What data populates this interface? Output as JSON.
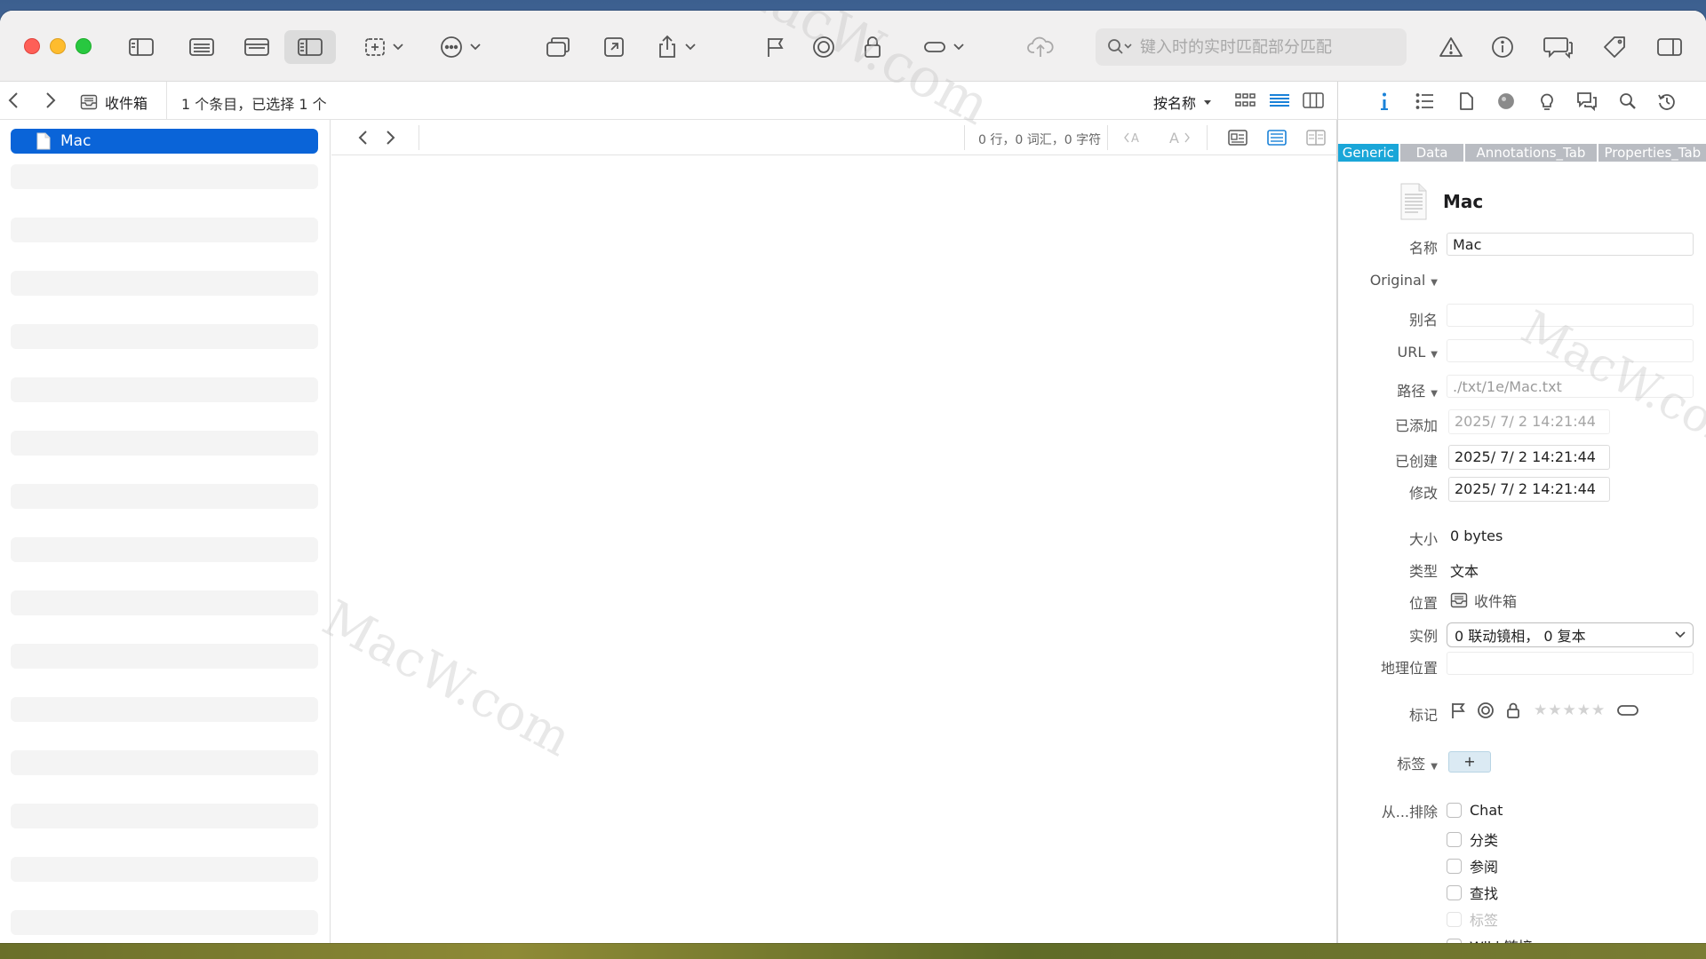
{
  "toolbar": {
    "search_placeholder": "键入时的实时匹配部分匹配"
  },
  "pathbar": {
    "location": "收件箱",
    "status": "1 个条目，已选择 1 个",
    "sort_label": "按名称"
  },
  "sidebar": {
    "selected_item": "Mac",
    "empty_row_count": 15
  },
  "editor": {
    "counts": "0 行，0 词汇，0 字符"
  },
  "inspector": {
    "tabs": [
      "Generic",
      "Data",
      "Annotations_Tab",
      "Properties_Tab"
    ],
    "active_tab": "Generic",
    "doc_title": "Mac",
    "fields": {
      "name_label": "名称",
      "name_value": "Mac",
      "original_label": "Original",
      "alias_label": "别名",
      "alias_value": "",
      "url_label": "URL",
      "url_value": "",
      "path_label": "路径",
      "path_value": "./txt/1e/Mac.txt",
      "added_label": "已添加",
      "added_value": "2025/  7/  2 14:21:44",
      "created_label": "已创建",
      "created_value": "2025/  7/  2 14:21:44",
      "modified_label": "修改",
      "modified_value": "2025/  7/  2 14:21:44",
      "size_label": "大小",
      "size_value": "0 bytes",
      "kind_label": "类型",
      "kind_value": "文本",
      "location_label": "位置",
      "location_value": "收件箱",
      "instances_label": "实例",
      "instances_value": "0 联动镜相，  0 复本",
      "geo_label": "地理位置",
      "geo_value": "",
      "marks_label": "标记",
      "tags_label": "标签",
      "tag_add": "+",
      "exclude_label": "从...排除"
    },
    "rating_stars": "★★★★★",
    "exclude_options": [
      {
        "label": "Chat",
        "checked": false,
        "disabled": false
      },
      {
        "label": "分类",
        "checked": false,
        "disabled": false
      },
      {
        "label": "参阅",
        "checked": false,
        "disabled": false
      },
      {
        "label": "查找",
        "checked": false,
        "disabled": false
      },
      {
        "label": "标签",
        "checked": false,
        "disabled": true
      },
      {
        "label": "Wiki 链接",
        "checked": false,
        "disabled": false
      }
    ]
  },
  "watermark": "MacW.com",
  "colors": {
    "accent": "#0a64d8",
    "tab_active": "#1aa6d8"
  }
}
